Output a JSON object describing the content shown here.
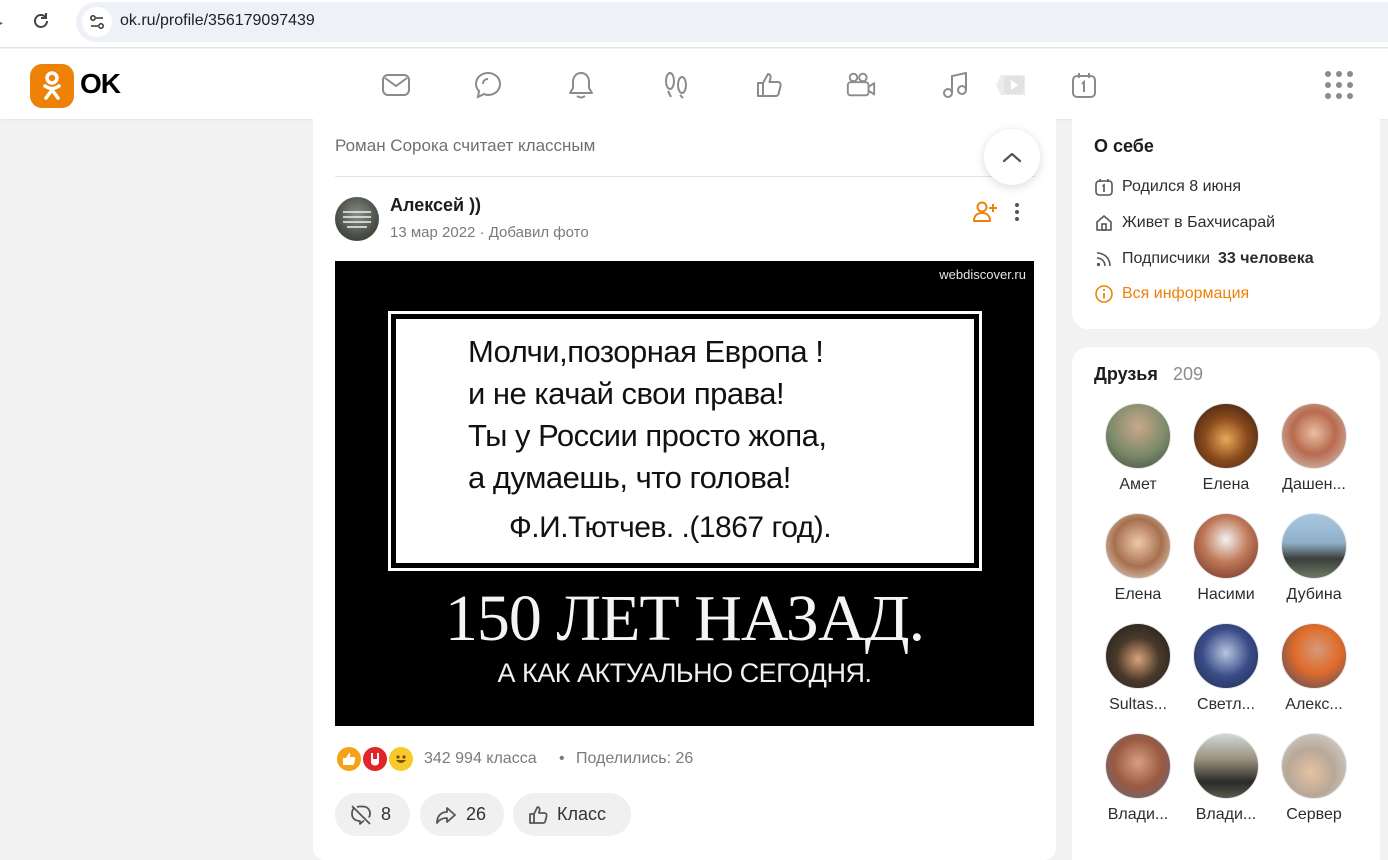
{
  "browser": {
    "url": "ok.ru/profile/356179097439"
  },
  "header": {
    "logo_text": "OK",
    "brand_color": "#ee8208",
    "nav_icons": [
      "messages-icon",
      "discussions-icon",
      "notifications-icon",
      "guests-icon",
      "events-icon",
      "video-icon",
      "music-icon",
      "games-icon",
      "calendar-icon"
    ]
  },
  "feed": {
    "header_text": "Роман Сорока считает классным",
    "post": {
      "author": "Алексей ))",
      "date": "13 мар 2022",
      "meta_separator": "·",
      "action": "Добавил фото",
      "image": {
        "watermark": "webdiscover.ru",
        "quote_lines": [
          "Молчи,позорная Европа !",
          "и не качай свои права!",
          "Ты у России просто жопа,",
          "а думаешь, что голова!"
        ],
        "quote_author": "Ф.И.Тютчев. .(1867 год).",
        "caption": "150 ЛЕТ НАЗАД.",
        "subcaption": "А КАК АКТУАЛЬНО СЕГОДНЯ."
      },
      "reactions": {
        "count_text": "342 994 класса",
        "dot": "•",
        "shares_text": "Поделились: 26"
      },
      "actions": {
        "comments": "8",
        "shares": "26",
        "like": "Класс"
      }
    }
  },
  "about": {
    "title": "О себе",
    "birthday": "Родился 8 июня",
    "lives": "Живет в Бахчисарай",
    "subscribers_label": "Подписчики",
    "subscribers_value": "33 человека",
    "all_info": "Вся информация"
  },
  "friends": {
    "title": "Друзья",
    "count": "209",
    "list": [
      {
        "name": "Амет"
      },
      {
        "name": "Елена"
      },
      {
        "name": "Дашен..."
      },
      {
        "name": "Елена"
      },
      {
        "name": "Насими"
      },
      {
        "name": "Дубина"
      },
      {
        "name": "Sultas..."
      },
      {
        "name": "Светл..."
      },
      {
        "name": "Алекс..."
      },
      {
        "name": "Влади..."
      },
      {
        "name": "Влади..."
      },
      {
        "name": "Сервер"
      }
    ]
  }
}
